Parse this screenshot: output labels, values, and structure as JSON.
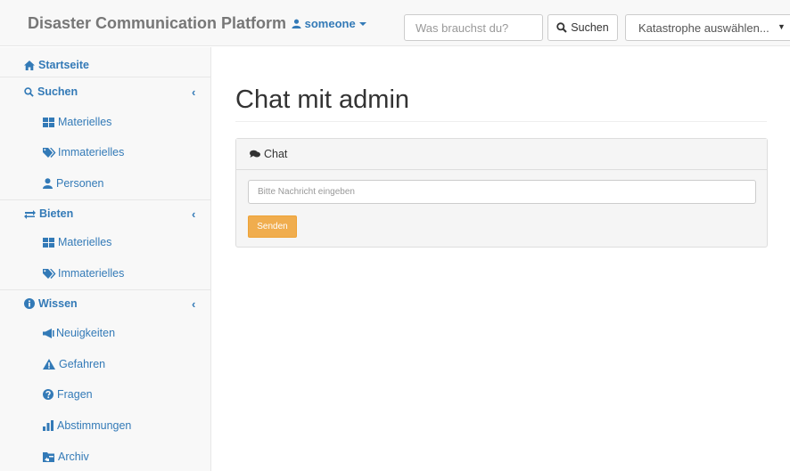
{
  "navbar": {
    "brand": "Disaster Communication Platform",
    "user_label": "someone",
    "search_placeholder": "Was brauchst du?",
    "search_button_label": "Suchen",
    "disaster_select_label": "Katastrophe auswählen...",
    "select_arrow": "▼"
  },
  "sidebar": {
    "home": "Startseite",
    "suchen": {
      "label": "Suchen",
      "items": [
        "Materielles",
        "Immaterielles",
        "Personen"
      ]
    },
    "bieten": {
      "label": "Bieten",
      "items": [
        "Materielles",
        "Immaterielles"
      ]
    },
    "wissen": {
      "label": "Wissen",
      "items": [
        "Neuigkeiten",
        "Gefahren",
        "Fragen",
        "Abstimmungen",
        "Archiv"
      ]
    },
    "chevron": "‹"
  },
  "main": {
    "title": "Chat mit admin",
    "panel_heading": "Chat",
    "message_placeholder": "Bitte Nachricht eingeben",
    "send_label": "Senden"
  },
  "colors": {
    "link": "#337ab7",
    "brand": "#777777",
    "warning": "#f0ad4e"
  }
}
